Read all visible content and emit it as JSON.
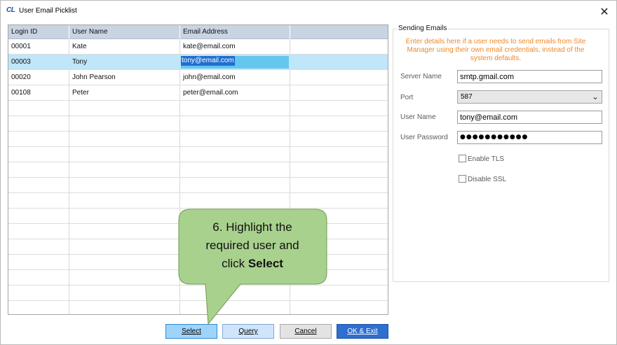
{
  "window": {
    "logo": "CL",
    "title": "User Email Picklist",
    "close_glyph": "✕"
  },
  "grid": {
    "columns": [
      "Login ID",
      "User Name",
      "Email Address",
      ""
    ],
    "rows": [
      {
        "login_id": "00001",
        "user_name": "Kate",
        "email": "kate@email.com"
      },
      {
        "login_id": "00003",
        "user_name": "Tony",
        "email": "tony@email.com"
      },
      {
        "login_id": "00020",
        "user_name": "John Pearson",
        "email": "john@email.com"
      },
      {
        "login_id": "00108",
        "user_name": "Peter",
        "email": "peter@email.com"
      }
    ],
    "selected_row": 1
  },
  "sending_emails": {
    "title": "Sending Emails",
    "note": "Enter details here if a user needs to send emails from Site Manager using their own email credentials, instead of the system defaults.",
    "server_name_label": "Server Name",
    "server_name_value": "smtp.gmail.com",
    "port_label": "Port",
    "port_value": "587",
    "user_name_label": "User Name",
    "user_name_value": "tony@email.com",
    "password_label": "User Password",
    "password_mask": "●●●●●●●●●●●",
    "enable_tls_label": "Enable TLS",
    "enable_tls_checked": false,
    "disable_ssl_label": "Disable SSL",
    "disable_ssl_checked": false
  },
  "buttons": {
    "select": "Select",
    "query": "Query",
    "cancel": "Cancel",
    "ok_exit": "OK & Exit"
  },
  "callout": {
    "line1": "6. Highlight the",
    "line2": "required user and",
    "line3_prefix": "click ",
    "line3_bold": "Select"
  },
  "colors": {
    "selected_row": "#bfe6f9",
    "note_orange": "#ee8a27",
    "callout_fill": "#a9d18e",
    "callout_stroke": "#6f9a4f",
    "ok_button": "#2e6fd0"
  }
}
